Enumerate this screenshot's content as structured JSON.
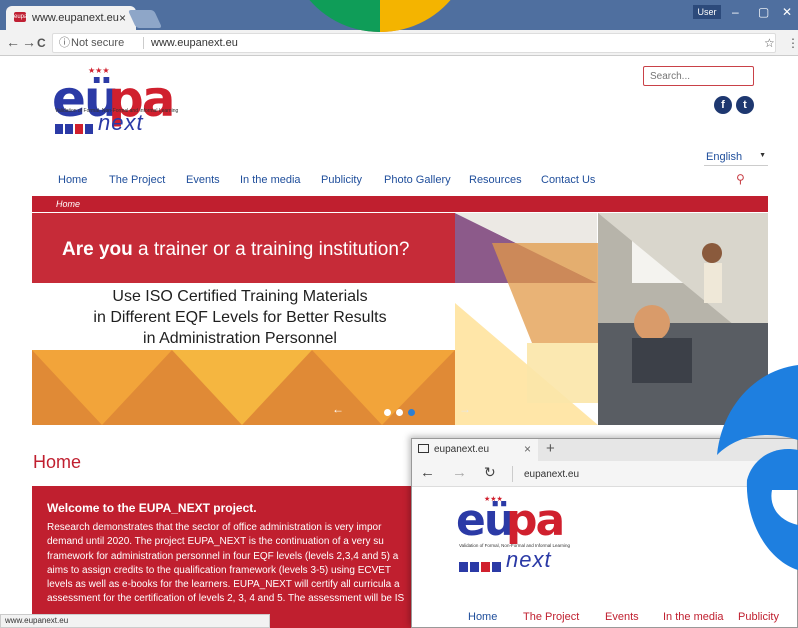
{
  "chrome": {
    "tab_title": "www.eupanext.eu",
    "tab_close": "×",
    "favicon_text": "eupa",
    "user_label": "User",
    "window_buttons": [
      "–",
      "▢",
      "✕"
    ],
    "nav": {
      "back": "←",
      "forward": "→",
      "reload": "C"
    },
    "info_icon": "ⓘ",
    "not_secure": "Not secure",
    "url": "www.eupanext.eu",
    "bookmark_star": "☆",
    "menu_icon": "⋮"
  },
  "site": {
    "logo": {
      "eu": "eü",
      "pa": "pa",
      "subtitle": "Validation of Formal, Non-Formal and Informal Learning",
      "next": "next",
      "bar_colors": [
        "#2b3aa6",
        "#2b3aa6",
        "#d0202e",
        "#2b3aa6"
      ]
    },
    "search_placeholder": "Search...",
    "social": {
      "facebook": "f",
      "twitter": "t"
    },
    "language": "English",
    "language_arrow": "▼",
    "nav_items": [
      "Home",
      "The Project",
      "Events",
      "In the media",
      "Publicity",
      "Photo Gallery",
      "Resources",
      "Contact Us"
    ],
    "search_icon": "⚲",
    "breadcrumb": "Home",
    "slider": {
      "headline_bold": "Are you",
      "headline_rest": " a trainer or a training institution?",
      "iso_lines": [
        "Use ISO Certified Training Materials",
        "in Different EQF Levels for Better Results",
        "in Administration Personnel"
      ],
      "arrow_prev": "←",
      "arrow_next": "→",
      "active_dot": 3
    },
    "home_heading": "Home",
    "welcome_title": "Welcome to the EUPA_NEXT project.",
    "welcome_lines": [
      "Research demonstrates that the sector of office administration is very impor",
      "demand until 2020. The project  EUPA_NEXT is the continuation of a very su",
      "framework for administration personnel in four EQF levels (levels 2,3,4 and 5) a",
      "aims to assign credits to the qualification framework (levels 3-5) using ECVET",
      "levels  as well as e-books for the learners. EUPA_NEXT will certify all curricula a",
      "assessment for the certification of levels 2, 3, 4 and 5. The assessment will be IS"
    ],
    "status_url": "www.eupanext.eu"
  },
  "edge": {
    "tab_title": "eupanext.eu",
    "tab_close": "×",
    "new_tab": "+",
    "nav": {
      "back": "←",
      "forward": "→",
      "reload": "↻"
    },
    "url": "eupanext.eu",
    "logo": {
      "eu": "eü",
      "pa": "pa",
      "subtitle": "Validation of Formal, Non-Formal and Informal Learning",
      "next": "next"
    },
    "nav_items": [
      "Home",
      "The Project",
      "Events",
      "In the media",
      "Publicity"
    ]
  },
  "colors": {
    "brand_red": "#c01f2f",
    "brand_blue": "#2b3aa6",
    "link_blue": "#1f4e9b"
  }
}
